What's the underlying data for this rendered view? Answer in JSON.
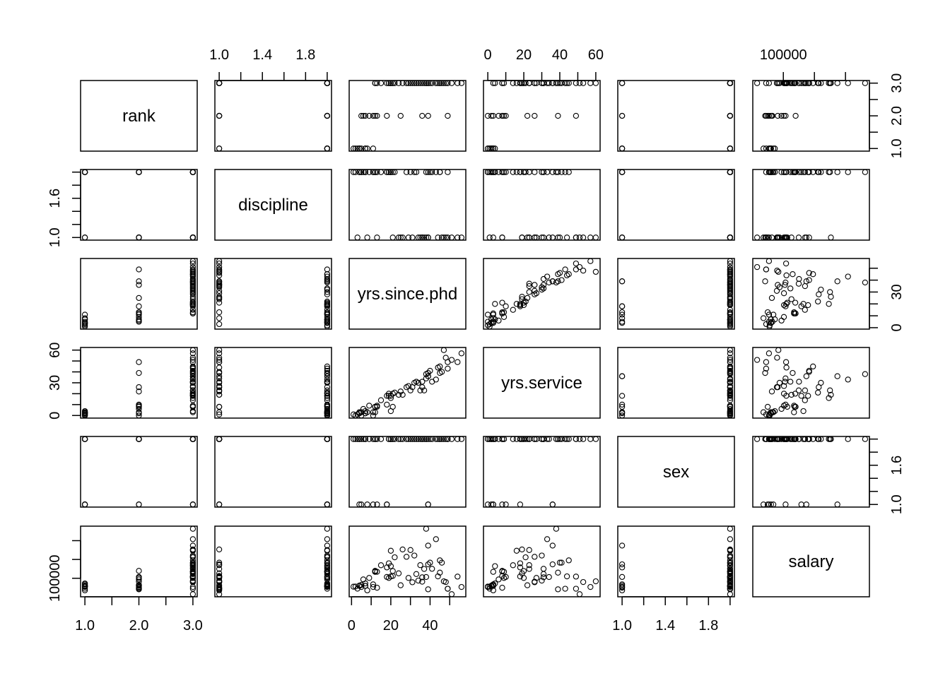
{
  "chart_data": {
    "type": "scatter",
    "subtype": "pairs-matrix",
    "title": "",
    "variables": [
      {
        "name": "rank",
        "range": [
          1,
          3
        ],
        "ticks": [
          1,
          1.5,
          2,
          2.5,
          3
        ],
        "labels": {
          "bottom": [
            "1.0",
            "2.0",
            "3.0"
          ],
          "right": [
            "1.0",
            "2.0",
            "3.0"
          ]
        }
      },
      {
        "name": "discipline",
        "range": [
          1,
          2
        ],
        "ticks": [
          1,
          1.2,
          1.4,
          1.6,
          1.8,
          2
        ],
        "labels": {
          "top": [
            "1.0",
            "1.4",
            "1.8"
          ],
          "left": [
            "1.0",
            "1.6"
          ]
        }
      },
      {
        "name": "yrs.since.phd",
        "range": [
          1,
          56
        ],
        "ticks": [
          0,
          10,
          20,
          30,
          40,
          50
        ],
        "labels": {
          "bottom": [
            "0",
            "20",
            "40"
          ],
          "right": [
            "0",
            "30"
          ]
        }
      },
      {
        "name": "yrs.service",
        "range": [
          0,
          60
        ],
        "ticks": [
          0,
          10,
          20,
          30,
          40,
          50,
          60
        ],
        "labels": {
          "top": [
            "0",
            "20",
            "40",
            "60"
          ],
          "left": [
            "0",
            "30",
            "60"
          ]
        }
      },
      {
        "name": "sex",
        "range": [
          1,
          2
        ],
        "ticks": [
          1,
          1.2,
          1.4,
          1.6,
          1.8,
          2
        ],
        "labels": {
          "bottom": [
            "1.0",
            "1.4",
            "1.8"
          ],
          "right": [
            "1.0",
            "1.6"
          ]
        }
      },
      {
        "name": "salary",
        "range": [
          57800,
          231545
        ],
        "ticks": [
          100000,
          150000,
          200000
        ],
        "labels": {
          "top": [
            "100000"
          ],
          "left": [
            "100000"
          ]
        }
      }
    ],
    "label_values": {
      "rank": [
        1,
        2,
        3
      ],
      "discipline": [
        1,
        1.4,
        1.8
      ],
      "yrs.since.phd": [
        0,
        20,
        40
      ],
      "yrs.since.phd_right": [
        0,
        30
      ],
      "yrs.service": [
        0,
        20,
        40,
        60
      ],
      "yrs.service_left": [
        0,
        30,
        60
      ],
      "sex": [
        1,
        1.4,
        1.8
      ],
      "sex_right": [
        1,
        1.6
      ],
      "discipline_left": [
        1,
        1.6
      ],
      "salary": [
        100000
      ]
    },
    "rows": [
      [
        3,
        2,
        19,
        18,
        2,
        139750
      ],
      [
        3,
        2,
        20,
        16,
        2,
        173200
      ],
      [
        1,
        2,
        4,
        3,
        2,
        79750
      ],
      [
        3,
        2,
        45,
        39,
        2,
        115000
      ],
      [
        3,
        2,
        40,
        41,
        2,
        141500
      ],
      [
        2,
        2,
        6,
        6,
        2,
        97000
      ],
      [
        3,
        2,
        30,
        23,
        2,
        175000
      ],
      [
        3,
        2,
        45,
        45,
        2,
        147765
      ],
      [
        3,
        2,
        21,
        20,
        2,
        119250
      ],
      [
        3,
        2,
        18,
        18,
        1,
        129000
      ],
      [
        2,
        2,
        12,
        8,
        2,
        119800
      ],
      [
        1,
        2,
        7,
        2,
        2,
        79800
      ],
      [
        1,
        2,
        1,
        1,
        2,
        77700
      ],
      [
        1,
        2,
        2,
        0,
        2,
        78000
      ],
      [
        3,
        2,
        20,
        18,
        2,
        104800
      ],
      [
        3,
        2,
        12,
        3,
        2,
        117150
      ],
      [
        3,
        2,
        19,
        20,
        2,
        101000
      ],
      [
        3,
        1,
        38,
        34,
        2,
        103450
      ],
      [
        3,
        1,
        37,
        23,
        2,
        124750
      ],
      [
        3,
        1,
        39,
        36,
        1,
        137000
      ],
      [
        3,
        1,
        31,
        26,
        2,
        89565
      ],
      [
        3,
        1,
        36,
        31,
        2,
        102580
      ],
      [
        3,
        1,
        34,
        30,
        2,
        93904
      ],
      [
        3,
        1,
        24,
        19,
        2,
        113068
      ],
      [
        2,
        1,
        13,
        8,
        1,
        74830
      ],
      [
        3,
        1,
        21,
        8,
        2,
        106294
      ],
      [
        3,
        1,
        35,
        23,
        2,
        134885
      ],
      [
        2,
        2,
        5,
        3,
        2,
        82379
      ],
      [
        2,
        2,
        11,
        0,
        2,
        77000
      ],
      [
        3,
        2,
        12,
        8,
        2,
        118223
      ],
      [
        3,
        2,
        20,
        4,
        2,
        132261
      ],
      [
        2,
        2,
        7,
        2,
        2,
        79916
      ],
      [
        3,
        2,
        13,
        9,
        2,
        117256
      ],
      [
        1,
        2,
        4,
        2,
        2,
        80225
      ],
      [
        1,
        2,
        4,
        2,
        1,
        80225
      ],
      [
        1,
        2,
        5,
        0,
        1,
        77000
      ],
      [
        3,
        2,
        22,
        21,
        2,
        155750
      ],
      [
        1,
        2,
        7,
        4,
        2,
        86373
      ],
      [
        3,
        2,
        41,
        31,
        2,
        125196
      ],
      [
        2,
        2,
        9,
        9,
        2,
        100938
      ],
      [
        3,
        1,
        56,
        57,
        2,
        76840
      ],
      [
        3,
        1,
        46,
        40,
        2,
        141500
      ],
      [
        3,
        1,
        51,
        51,
        2,
        57800
      ],
      [
        3,
        1,
        54,
        49,
        2,
        104428
      ],
      [
        3,
        2,
        38,
        38,
        2,
        231545
      ],
      [
        3,
        2,
        43,
        33,
        2,
        204000
      ],
      [
        2,
        1,
        49,
        49,
        2,
        72300
      ],
      [
        2,
        1,
        25,
        22,
        2,
        81500
      ],
      [
        3,
        1,
        47,
        60,
        2,
        92000
      ],
      [
        3,
        2,
        49,
        43,
        2,
        72300
      ],
      [
        1,
        1,
        3,
        1,
        2,
        72500
      ],
      [
        1,
        1,
        8,
        3,
        1,
        68000
      ],
      [
        3,
        2,
        39,
        36,
        1,
        186960
      ],
      [
        2,
        2,
        18,
        10,
        1,
        103613
      ],
      [
        3,
        1,
        29,
        27,
        2,
        101036
      ],
      [
        3,
        1,
        26,
        19,
        2,
        176500
      ],
      [
        2,
        1,
        39,
        39,
        2,
        70700
      ],
      [
        3,
        2,
        33,
        31,
        2,
        111350
      ],
      [
        1,
        2,
        11,
        3,
        1,
        83900
      ],
      [
        3,
        2,
        32,
        30,
        2,
        160450
      ],
      [
        3,
        1,
        44,
        44,
        2,
        105000
      ],
      [
        2,
        1,
        36,
        26,
        2,
        91000
      ],
      [
        3,
        2,
        28,
        26,
        2,
        157000
      ],
      [
        3,
        1,
        48,
        53,
        2,
        90000
      ],
      [
        3,
        2,
        15,
        14,
        2,
        134800
      ]
    ],
    "point_style": "open-circle",
    "grid": false
  }
}
